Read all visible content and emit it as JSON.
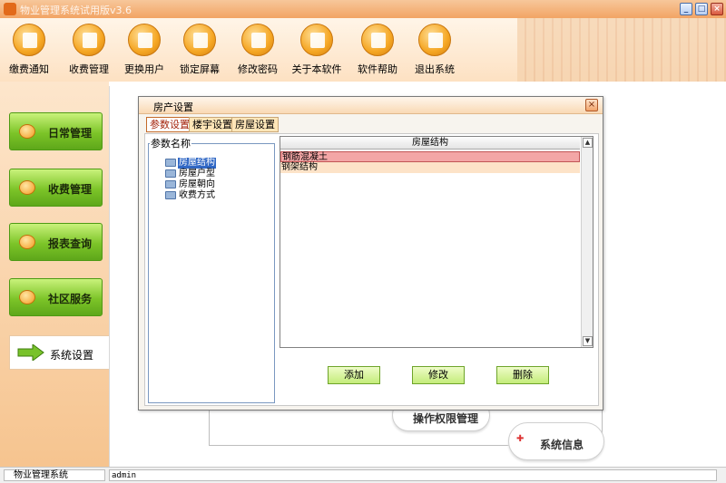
{
  "window": {
    "title": "物业管理系统试用版v3.6",
    "controls": [
      "_",
      "□",
      "×"
    ]
  },
  "toolbar": {
    "buttons": [
      {
        "label": "缴费通知",
        "icon": "megaphone-icon"
      },
      {
        "label": "收费管理",
        "icon": "ledger-icon"
      },
      {
        "label": "更换用户",
        "icon": "user-switch-icon"
      },
      {
        "label": "锁定屏幕",
        "icon": "lock-screen-icon"
      },
      {
        "label": "修改密码",
        "icon": "key-icon"
      },
      {
        "label": "关于本软件",
        "icon": "about-icon"
      },
      {
        "label": "软件帮助",
        "icon": "help-icon"
      },
      {
        "label": "退出系统",
        "icon": "power-icon"
      }
    ]
  },
  "sidebar": {
    "items": [
      {
        "label": "日常管理"
      },
      {
        "label": "收费管理"
      },
      {
        "label": "报表查询"
      },
      {
        "label": "社区服务"
      }
    ],
    "active": {
      "label": "系统设置"
    }
  },
  "background": {
    "pill_permission": "操作权限管理",
    "pill_sysinfo": "系统信息"
  },
  "dialog": {
    "title": "房产设置",
    "close": "×",
    "tabs": [
      "参数设置",
      "楼宇设置",
      "房屋设置"
    ],
    "tree": {
      "legend": "参数名称",
      "items": [
        "房屋结构",
        "房屋户型",
        "房屋朝向",
        "收费方式"
      ],
      "selected_index": 0
    },
    "grid": {
      "header": "房屋结构",
      "rows": [
        "钢筋混凝土",
        "钢架结构"
      ],
      "scroll_up": "▲",
      "scroll_down": "▼"
    },
    "actions": {
      "add": "添加",
      "edit": "修改",
      "delete": "删除"
    }
  },
  "statusbar": {
    "app": "物业管理系统",
    "user": "admin"
  }
}
